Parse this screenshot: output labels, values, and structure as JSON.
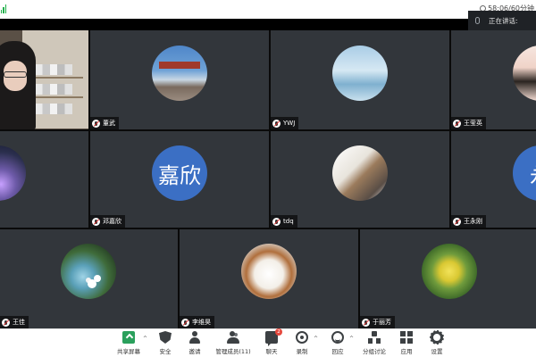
{
  "status": {
    "timer_text": "58:06/60分钟"
  },
  "speaking": {
    "label": "正在讲话:"
  },
  "participants": [
    {
      "name": "",
      "avatar": "camera-video"
    },
    {
      "name": "董武",
      "avatar": "photo-bridge"
    },
    {
      "name": "YWJ",
      "avatar": "photo-sky"
    },
    {
      "name": "王莹英",
      "avatar": "photo-girl"
    },
    {
      "name": "",
      "avatar": "photo-night"
    },
    {
      "name": "邓嘉欣",
      "avatar": "initials",
      "initials": "嘉欣"
    },
    {
      "name": "tdq",
      "avatar": "photo-figures"
    },
    {
      "name": "王永刚",
      "avatar": "initials",
      "initials": "永"
    },
    {
      "name": "王佳",
      "avatar": "photo-garden"
    },
    {
      "name": "李维昊",
      "avatar": "photo-dog"
    },
    {
      "name": "于丽芳",
      "avatar": "photo-flowers"
    }
  ],
  "toolbar": {
    "share_screen": "共享屏幕",
    "security": "安全",
    "invite": "邀请",
    "manage_members": "管理成员(11)",
    "chat": "聊天",
    "chat_badge": "2",
    "record": "录制",
    "reactions": "回应",
    "breakout": "分组讨论",
    "apps": "应用",
    "settings": "设置"
  },
  "colors": {
    "accent_green": "#2aa05c",
    "tile_bg": "#32363b",
    "initials_blue": "#3b6fc4",
    "badge_red": "#e5483d"
  }
}
